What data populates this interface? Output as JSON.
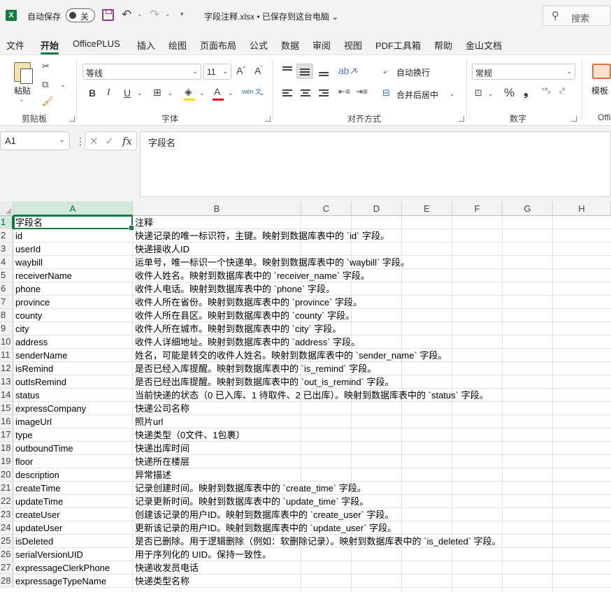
{
  "titlebar": {
    "autosave_label": "自动保存",
    "autosave_state": "关",
    "filename": "字段注释.xlsx • 已保存到这台电脑",
    "search_placeholder": "搜索"
  },
  "tabs": [
    "文件",
    "开始",
    "OfficePLUS",
    "插入",
    "绘图",
    "页面布局",
    "公式",
    "数据",
    "审阅",
    "视图",
    "PDF工具箱",
    "帮助",
    "金山文档"
  ],
  "active_tab": "开始",
  "ribbon": {
    "clipboard_group": "剪贴板",
    "paste_label": "粘贴",
    "font_group": "字体",
    "font_name": "等线",
    "font_size": "11",
    "bold": "B",
    "italic": "I",
    "underline": "U",
    "align_group": "对齐方式",
    "wrap_text": "自动换行",
    "merge_center": "合并后居中",
    "number_group": "数字",
    "number_format": "常规",
    "template_label": "模板",
    "offi_label": "Offi",
    "phonetic_label": "wén 文",
    "highlight_color": "#ffd800",
    "font_color": "#e81123"
  },
  "formula_bar": {
    "name_box": "A1",
    "content": "字段名"
  },
  "grid": {
    "col_headers": [
      "A",
      "B",
      "C",
      "D",
      "E",
      "F",
      "G",
      "H"
    ],
    "rows": [
      {
        "n": "1",
        "a": "字段名",
        "b": "注释"
      },
      {
        "n": "2",
        "a": "id",
        "b": "快递记录的唯一标识符，主键。映射到数据库表中的 `id` 字段。"
      },
      {
        "n": "3",
        "a": "userId",
        "b": "快递接收人ID"
      },
      {
        "n": "4",
        "a": "waybill",
        "b": "运单号，唯一标识一个快递单。映射到数据库表中的 `waybill` 字段。"
      },
      {
        "n": "5",
        "a": "receiverName",
        "b": "收件人姓名。映射到数据库表中的 `receiver_name` 字段。"
      },
      {
        "n": "6",
        "a": "phone",
        "b": "收件人电话。映射到数据库表中的 `phone` 字段。"
      },
      {
        "n": "7",
        "a": "province",
        "b": "收件人所在省份。映射到数据库表中的 `province` 字段。"
      },
      {
        "n": "8",
        "a": "county",
        "b": "收件人所在县区。映射到数据库表中的 `county` 字段。"
      },
      {
        "n": "9",
        "a": "city",
        "b": "收件人所在城市。映射到数据库表中的 `city` 字段。"
      },
      {
        "n": "10",
        "a": "address",
        "b": "收件人详细地址。映射到数据库表中的 `address` 字段。"
      },
      {
        "n": "11",
        "a": "senderName",
        "b": "姓名，可能是转交的收件人姓名。映射到数据库表中的 `sender_name` 字段。"
      },
      {
        "n": "12",
        "a": "isRemind",
        "b": "是否已经入库提醒。映射到数据库表中的 `is_remind` 字段。"
      },
      {
        "n": "13",
        "a": "outIsRemind",
        "b": "是否已经出库提醒。映射到数据库表中的 `out_is_remind` 字段。"
      },
      {
        "n": "14",
        "a": "status",
        "b": "当前快递的状态（0 已入库、1 待取件、2 已出库）。映射到数据库表中的 `status` 字段。"
      },
      {
        "n": "15",
        "a": "expressCompany",
        "b": "快递公司名称"
      },
      {
        "n": "16",
        "a": "imageUrl",
        "b": "照片url"
      },
      {
        "n": "17",
        "a": "type",
        "b": "快递类型（0文件、1包裹）"
      },
      {
        "n": "18",
        "a": "outboundTime",
        "b": "快递出库时间"
      },
      {
        "n": "19",
        "a": "floor",
        "b": "快递所在楼层"
      },
      {
        "n": "20",
        "a": "description",
        "b": "异常描述"
      },
      {
        "n": "21",
        "a": "createTime",
        "b": "记录创建时间。映射到数据库表中的 `create_time` 字段。"
      },
      {
        "n": "22",
        "a": "updateTime",
        "b": "记录更新时间。映射到数据库表中的 `update_time` 字段。"
      },
      {
        "n": "23",
        "a": "createUser",
        "b": "创建该记录的用户ID。映射到数据库表中的 `create_user` 字段。"
      },
      {
        "n": "24",
        "a": "updateUser",
        "b": "更新该记录的用户ID。映射到数据库表中的 `update_user` 字段。"
      },
      {
        "n": "25",
        "a": "isDeleted",
        "b": "是否已删除。用于逻辑删除（例如：软删除记录）。映射到数据库表中的 `is_deleted` 字段。"
      },
      {
        "n": "26",
        "a": "serialVersionUID",
        "b": "用于序列化的 UID。保持一致性。"
      },
      {
        "n": "27",
        "a": "expressageClerkPhone",
        "b": "快递收发员电话"
      },
      {
        "n": "28",
        "a": "expressageTypeName",
        "b": "快递类型名称"
      }
    ]
  }
}
